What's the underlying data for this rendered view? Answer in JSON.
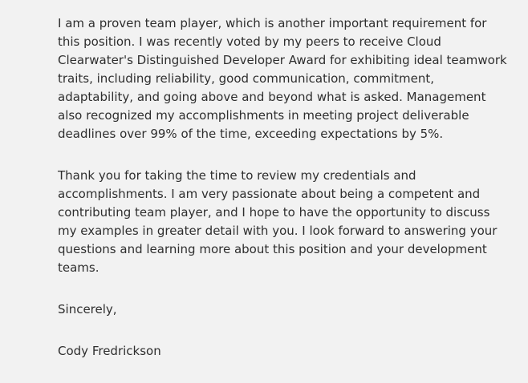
{
  "letter": {
    "paragraphs": [
      "I am a proven team player, which is another important requirement for this position. I was recently voted by my peers to receive Cloud Clearwater's Distinguished Developer Award for exhibiting ideal teamwork traits, including reliability, good communication, commitment, adaptability, and going above and beyond what is asked. Management also recognized my accomplishments in meeting project deliverable deadlines over 99% of the time, exceeding expectations by 5%.",
      "Thank you for taking the time to review my credentials and accomplishments. I am very passionate about being a competent and contributing team player, and I hope to have the opportunity to discuss my examples in greater detail with you. I look forward to answering your questions and learning more about this position and your development teams."
    ],
    "closing": "Sincerely,",
    "signature": "Cody Fredrickson"
  }
}
